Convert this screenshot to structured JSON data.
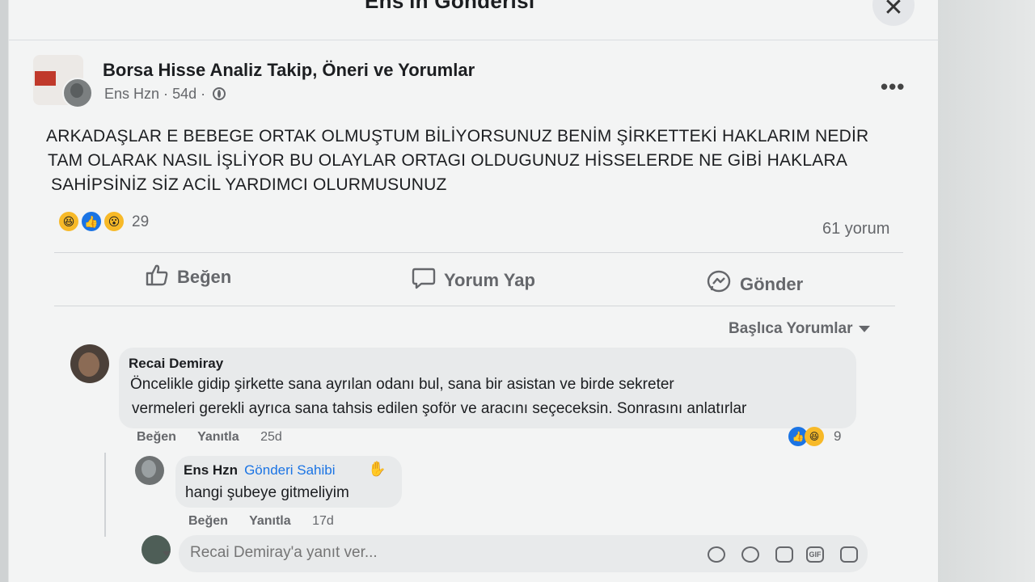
{
  "modal": {
    "title": "Ens'in Gönderisi",
    "close_glyph": "✕"
  },
  "post": {
    "group_name": "Borsa Hisse Analiz Takip, Öneri ve Yorumlar",
    "author": "Ens Hzn",
    "time": "54d",
    "separator": "·",
    "text_lines": [
      "ARKADAŞLAR E BEBEGE ORTAK OLMUŞTUM BİLİYORSUNUZ BENİM ŞİRKETTEKİ HAKLARIM NEDİR",
      "TAM OLARAK NASIL İŞLİYOR BU OLAYLAR ORTAGI OLDUGUNUZ HİSSELERDE NE GİBİ HAKLARA",
      "SAHİPSİNİZ SİZ ACİL YARDIMCI OLURMUSUNUZ"
    ],
    "reaction_count": "29",
    "comment_count": "61 yorum",
    "more_glyph": "•••"
  },
  "actions": {
    "like": "Beğen",
    "comment": "Yorum Yap",
    "send": "Gönder"
  },
  "sort": {
    "label": "Başlıca Yorumlar"
  },
  "comments": [
    {
      "author": "Recai Demiray",
      "lines": [
        "Öncelikle gidip şirkette sana ayrılan odanı bul, sana bir asistan ve birde sekreter",
        "vermeleri gerekli ayrıca sana tahsis edilen şoför ve aracını seçeceksin. Sonrasını anlatırlar"
      ],
      "like": "Beğen",
      "reply": "Yanıtla",
      "time": "25d",
      "reaction_count": "9"
    },
    {
      "author": "Ens Hzn",
      "badge": "Gönderi Sahibi",
      "text": "hangi şubeye gitmeliyim",
      "like": "Beğen",
      "reply": "Yanıtla",
      "time": "17d"
    }
  ],
  "reply_box": {
    "placeholder": "Recai Demiray'a yanıt ver...",
    "tools": [
      "sticker-icon",
      "emoji-icon",
      "camera-icon",
      "gif-icon",
      "avatar-sticker-icon"
    ],
    "gif_label": "GIF"
  },
  "colors": {
    "accent": "#1b74e4",
    "muted_text": "#65676b",
    "reaction_yellow": "#f7b928"
  }
}
